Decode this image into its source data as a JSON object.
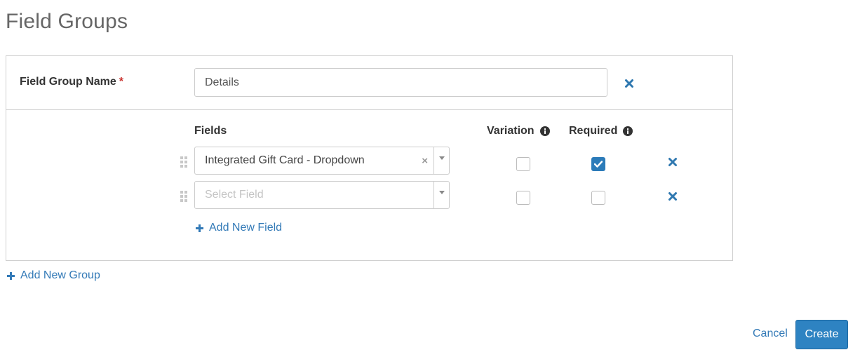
{
  "page": {
    "title": "Field Groups"
  },
  "group": {
    "name_label": "Field Group Name",
    "required_marker": "*",
    "name_value": "Details",
    "name_placeholder": ""
  },
  "columns": {
    "fields": "Fields",
    "variation": "Variation",
    "required": "Required"
  },
  "rows": [
    {
      "field": "Integrated Gift Card - Dropdown",
      "clear": "×",
      "variation": false,
      "required": true
    },
    {
      "placeholder": "Select Field",
      "variation": false,
      "required": false
    }
  ],
  "actions": {
    "add_field": "Add New Field",
    "add_group": "Add New Group",
    "cancel": "Cancel",
    "create": "Create"
  },
  "icons": {
    "remove": "times-icon",
    "info": "info-circle-icon",
    "drag": "drag-handle-icon",
    "add": "plus-icon",
    "check": "check-icon"
  },
  "colors": {
    "accent": "#337ab7",
    "button_bg": "#2e83c2",
    "checkbox_checked": "#2b7bb9",
    "required_star": "#c9302c",
    "remove_icon": "#2f78b0"
  }
}
